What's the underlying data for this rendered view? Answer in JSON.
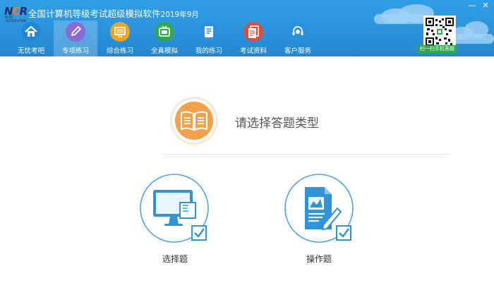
{
  "app": {
    "logo_text": "NCRE",
    "logo_sub": "NCRE CERTIFICATION",
    "title": "全国计算机等级考试超级模拟软件",
    "title_suffix": "2019年9月"
  },
  "window_controls": {
    "minimize": "—",
    "close": "✕"
  },
  "nav": {
    "items": [
      {
        "label": "无忧考吧",
        "icon": "home-icon",
        "color": "#1e88d6"
      },
      {
        "label": "专项练习",
        "icon": "pencil-icon",
        "color": "#8a68d6"
      },
      {
        "label": "综合练习",
        "icon": "monitor-icon",
        "color": "#f2a31c"
      },
      {
        "label": "全真模拟",
        "icon": "tv-icon",
        "color": "#2eaa4a"
      },
      {
        "label": "我的练习",
        "icon": "document-icon",
        "color": "#2b8fe0"
      },
      {
        "label": "考试资料",
        "icon": "files-icon",
        "color": "#e5483a"
      },
      {
        "label": "客户服务",
        "icon": "headset-icon",
        "color": "#2b8fe0"
      }
    ],
    "active_index": 1
  },
  "qr": {
    "badge": "扫一扫手机答题"
  },
  "main": {
    "prompt": "请选择答题类型",
    "choices": [
      {
        "label": "选择题",
        "icon": "computer-checklist-icon"
      },
      {
        "label": "操作题",
        "icon": "document-pen-icon"
      }
    ]
  },
  "colors": {
    "header": "#2b93dc",
    "accent_blue": "#2f93d6",
    "prompt_orange": "#f3a24a"
  }
}
